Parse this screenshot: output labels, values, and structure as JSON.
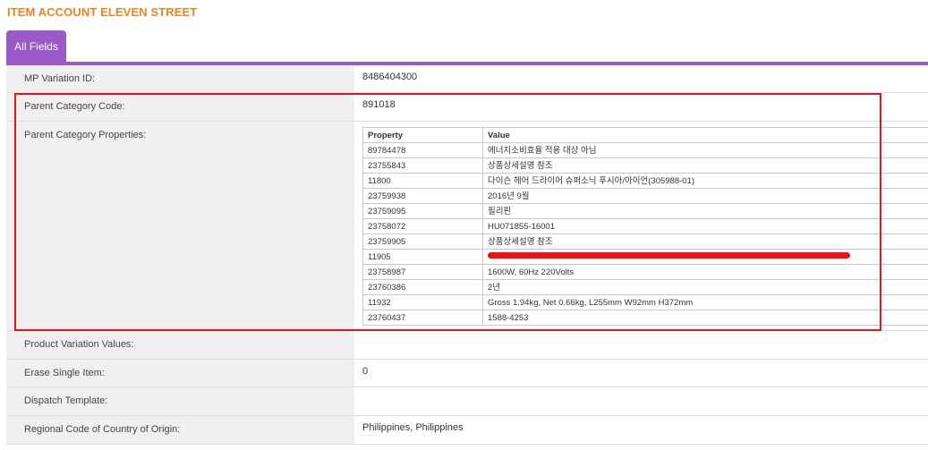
{
  "page": {
    "title": "ITEM ACCOUNT ELEVEN STREET"
  },
  "tabs": [
    {
      "label": "All Fields",
      "active": true
    }
  ],
  "colors": {
    "accent": "#9b59c9",
    "title": "#f0821e",
    "highlight": "#e0161e"
  },
  "fields": {
    "mp_variation_id": {
      "label": "MP Variation ID:",
      "value": "8486404300"
    },
    "parent_category_code": {
      "label": "Parent Category Code:",
      "value": "891018"
    },
    "parent_category_properties": {
      "label": "Parent Category Properties:",
      "headers": {
        "property": "Property",
        "value": "Value"
      },
      "rows": [
        {
          "property": "89784478",
          "value": "에너지소비효율 적용 대상 아님"
        },
        {
          "property": "23755843",
          "value": "상품상세설명 참조"
        },
        {
          "property": "11800",
          "value": "다이슨 헤어 드라이어 슈퍼소닉 푸시아/아이언(305988-01)"
        },
        {
          "property": "23759938",
          "value": "2016년 9월"
        },
        {
          "property": "23759095",
          "value": "필리핀"
        },
        {
          "property": "23758072",
          "value": "HU071855-16001"
        },
        {
          "property": "23759905",
          "value": "상품상세설명 참조"
        },
        {
          "property": "11905",
          "value": "",
          "redacted": true
        },
        {
          "property": "23758987",
          "value": "1600W, 60Hz 220Volts"
        },
        {
          "property": "23760386",
          "value": "2년"
        },
        {
          "property": "11932",
          "value": "Gross 1.94kg, Net 0.66kg, L255mm W92mm H372mm"
        },
        {
          "property": "23760437",
          "value": "1588-4253"
        }
      ]
    },
    "product_variation_values": {
      "label": "Product Variation Values:",
      "value": ""
    },
    "erase_single_item": {
      "label": "Erase Single Item:",
      "value": "0"
    },
    "dispatch_template": {
      "label": "Dispatch Template:",
      "value": ""
    },
    "regional_code_origin": {
      "label": "Regional Code of Country of Origin:",
      "value": "Philippines, Philippines"
    }
  }
}
